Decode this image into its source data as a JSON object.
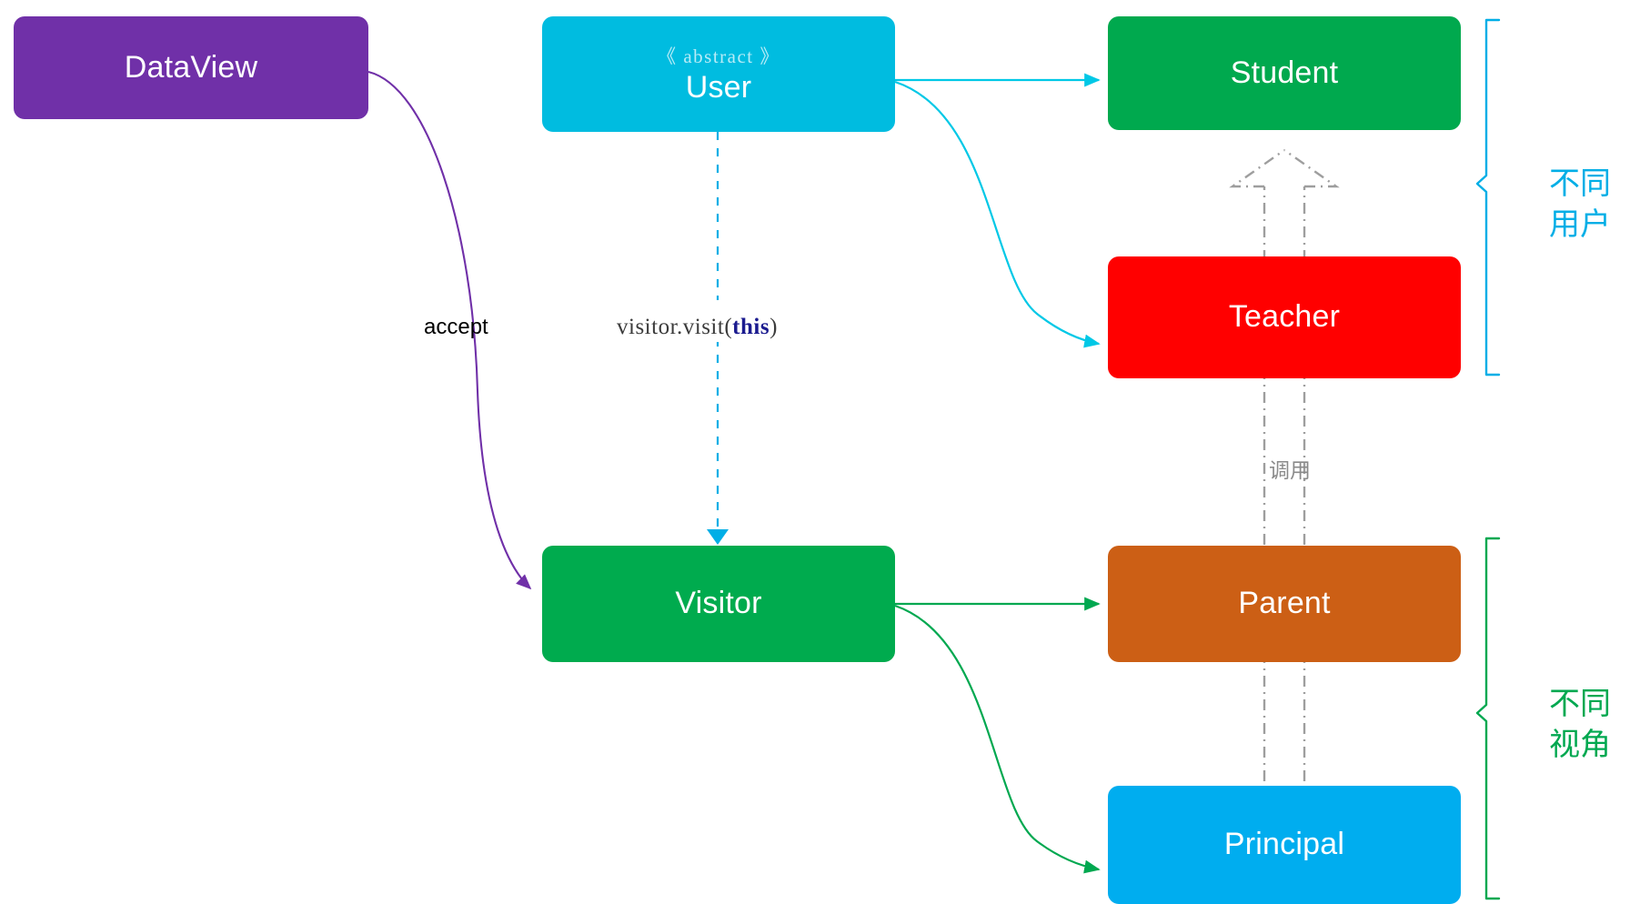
{
  "diagram": {
    "title": "Visitor pattern class diagram",
    "background": "#ffffff"
  },
  "nodes": {
    "dataview": {
      "label": "DataView",
      "color": "#7030A8"
    },
    "user": {
      "stereotype": "《 abstract 》",
      "label": "User",
      "color": "#00BCE0"
    },
    "student": {
      "label": "Student",
      "color": "#00A94E"
    },
    "teacher": {
      "label": "Teacher",
      "color": "#FF0000"
    },
    "visitor": {
      "label": "Visitor",
      "color": "#00AB4E"
    },
    "parent": {
      "label": "Parent",
      "color": "#CC5F15"
    },
    "principal": {
      "label": "Principal",
      "color": "#00ADEF"
    }
  },
  "edges": {
    "accept": {
      "label": "accept",
      "color": "#7030A8",
      "from": "dataview",
      "to": "visitor"
    },
    "visit": {
      "label_prefix": "visitor.visit(",
      "label_keyword": "this",
      "label_suffix": ")",
      "color": "#00AEE6",
      "from": "user",
      "to": "visitor"
    },
    "user_student": {
      "label": "",
      "color": "#00C8E6",
      "from": "user",
      "to": "student"
    },
    "user_teacher": {
      "label": "",
      "color": "#00C8E6",
      "from": "user",
      "to": "teacher"
    },
    "visitor_parent": {
      "label": "",
      "color": "#00A850",
      "from": "visitor",
      "to": "parent"
    },
    "visitor_principal": {
      "label": "",
      "color": "#00A850",
      "from": "visitor",
      "to": "principal"
    },
    "call": {
      "label": "调用",
      "color": "#9e9e9e",
      "from": "principal",
      "to": "student"
    }
  },
  "groups": {
    "users": {
      "label": "不同\n用户",
      "line1": "不同",
      "line2": "用户",
      "color": "#00AEE6"
    },
    "views": {
      "label": "不同\n视角",
      "line1": "不同",
      "line2": "视角",
      "color": "#00A850"
    }
  }
}
